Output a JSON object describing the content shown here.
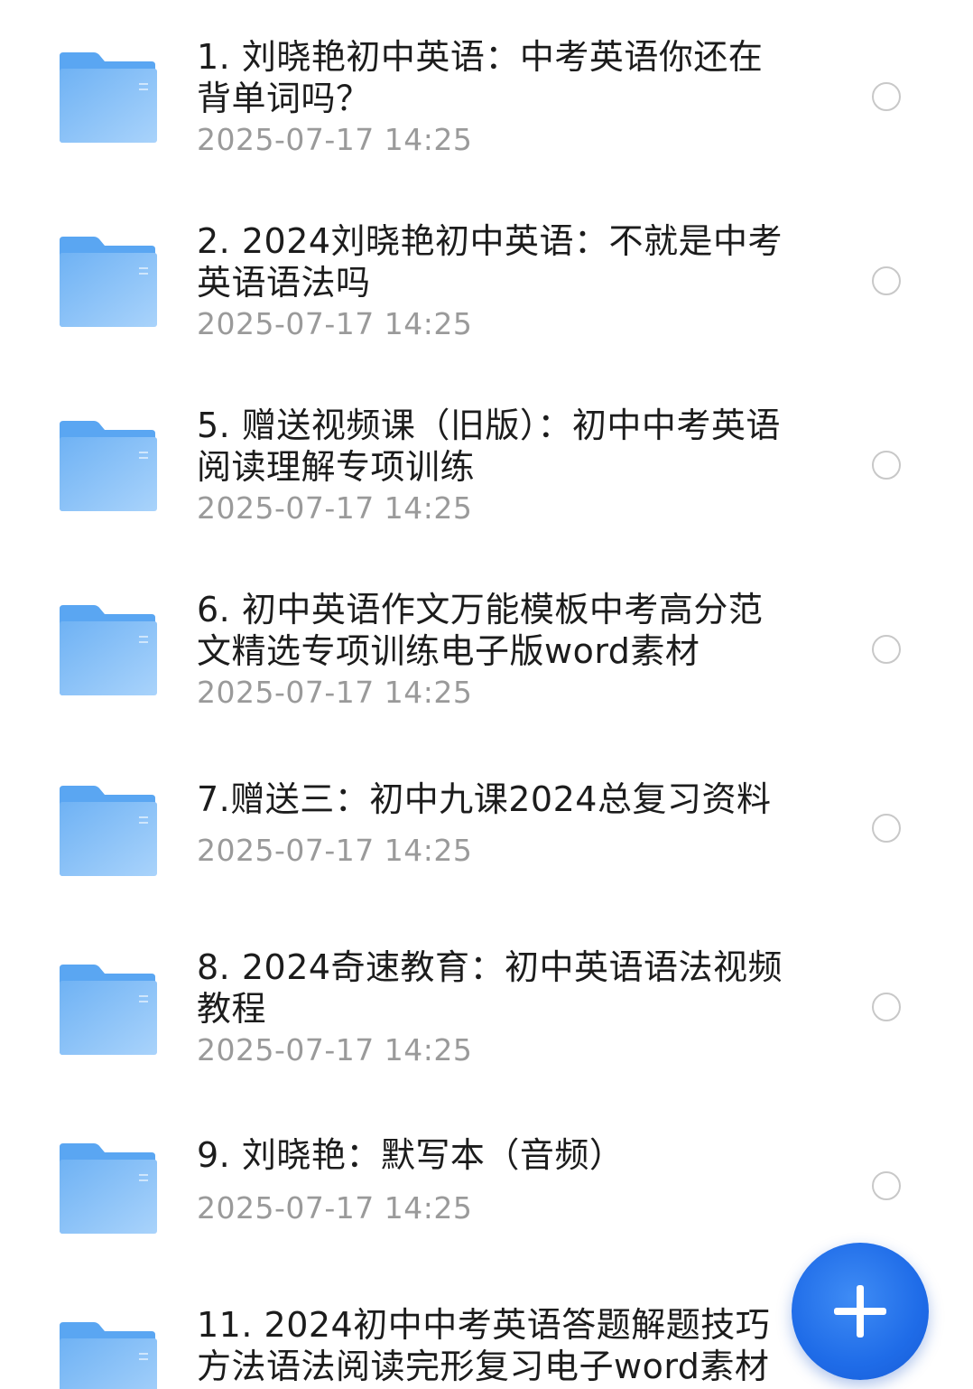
{
  "files": [
    {
      "title": "1. 刘晓艳初中英语：中考英语你还在背单词吗？",
      "time": "2025-07-17 14:25",
      "icon": "folder-icon"
    },
    {
      "title": "2. 2024刘晓艳初中英语：不就是中考英语语法吗",
      "time": "2025-07-17 14:25",
      "icon": "folder-icon"
    },
    {
      "title": "5. 赠送视频课（旧版）：初中中考英语阅读理解专项训练",
      "time": "2025-07-17 14:25",
      "icon": "folder-icon"
    },
    {
      "title": "6. 初中英语作文万能模板中考高分范文精选专项训练电子版word素材",
      "time": "2025-07-17 14:25",
      "icon": "folder-icon"
    },
    {
      "title": "7.赠送三：初中九课2024总复习资料",
      "time": "2025-07-17 14:25",
      "icon": "folder-icon"
    },
    {
      "title": "8. 2024奇速教育：初中英语语法视频教程",
      "time": "2025-07-17 14:25",
      "icon": "folder-icon"
    },
    {
      "title": "9. 刘晓艳：默写本（音频）",
      "time": "2025-07-17 14:25",
      "icon": "folder-icon"
    },
    {
      "title": "11. 2024初中中考英语答题解题技巧方法语法阅读完形复习电子word素材",
      "time": "",
      "icon": "folder-icon"
    }
  ],
  "fab": {
    "icon": "plus-icon"
  },
  "colors": {
    "folder": "#7bbaf5",
    "accent": "#1f6ce8",
    "timestamp": "#9a9a9a",
    "radio_border": "#c8c8c8"
  }
}
